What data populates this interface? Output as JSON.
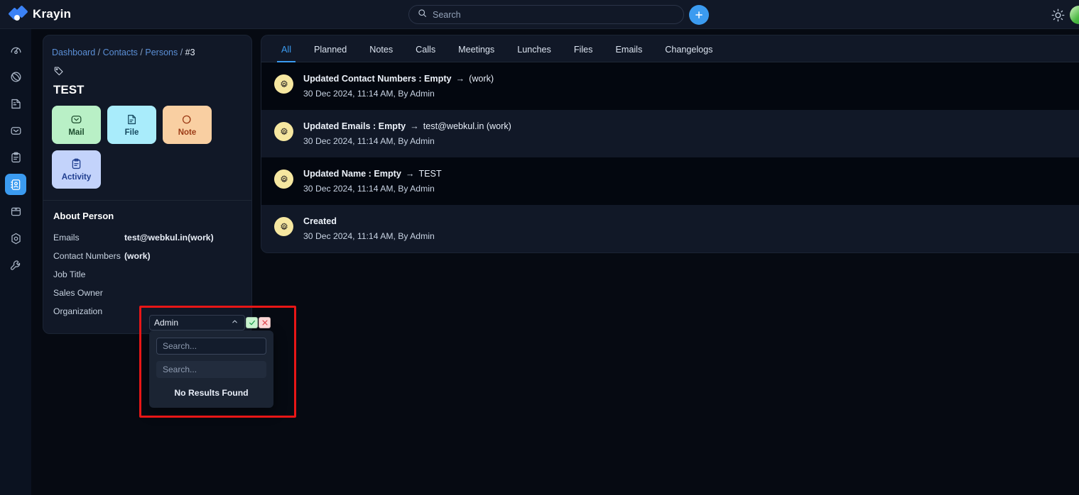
{
  "brand": {
    "name": "Krayin",
    "logo_icon": "krayin-diamond-logo"
  },
  "header": {
    "search_placeholder": "Search",
    "search_value": "",
    "search_icon": "search-icon",
    "create_button_icon": "plus-icon",
    "theme_toggle_icon": "sun-icon",
    "avatar_icon": "user-avatar"
  },
  "sidebar": {
    "items": [
      {
        "name": "dashboard",
        "icon": "speedometer-icon",
        "active": false
      },
      {
        "name": "leads",
        "icon": "atom-icon",
        "active": false
      },
      {
        "name": "quotes",
        "icon": "document-icon",
        "active": false
      },
      {
        "name": "mail",
        "icon": "envelope-icon",
        "active": false
      },
      {
        "name": "activities",
        "icon": "clipboard-icon",
        "active": false
      },
      {
        "name": "contacts",
        "icon": "contact-card-icon",
        "active": true
      },
      {
        "name": "products",
        "icon": "box-icon",
        "active": false
      },
      {
        "name": "settings",
        "icon": "hexagon-gear-icon",
        "active": false
      },
      {
        "name": "configuration",
        "icon": "wrench-icon",
        "active": false
      }
    ]
  },
  "left_panel": {
    "breadcrumb": [
      {
        "label": "Dashboard",
        "current": false
      },
      {
        "label": "Contacts",
        "current": false
      },
      {
        "label": "Persons",
        "current": false
      },
      {
        "label": "#3",
        "current": true
      }
    ],
    "tag_icon": "tag-icon",
    "person_name": "TEST",
    "action_cards": [
      {
        "label": "Mail",
        "icon": "envelope-icon",
        "theme": "mail"
      },
      {
        "label": "File",
        "icon": "file-icon",
        "theme": "file"
      },
      {
        "label": "Note",
        "icon": "note-icon",
        "theme": "note"
      },
      {
        "label": "Activity",
        "icon": "clipboard-icon",
        "theme": "activity"
      }
    ],
    "about_title": "About Person",
    "fields": [
      {
        "label": "Emails",
        "value": "test@webkul.in(work)"
      },
      {
        "label": "Contact Numbers",
        "value": "(work)"
      },
      {
        "label": "Job Title",
        "value": ""
      },
      {
        "label": "Sales Owner",
        "value": ""
      },
      {
        "label": "Organization",
        "value": ""
      }
    ]
  },
  "sales_owner_dropdown": {
    "selected_value": "Admin",
    "chevron_icon": "chevron-up-icon",
    "confirm_icon": "check-icon",
    "cancel_icon": "x-icon",
    "search_placeholder_1": "Search...",
    "search_value_1": "",
    "search_placeholder_2": "Search...",
    "search_value_2": "",
    "empty_text": "No Results Found",
    "highlight_color": "#e81616"
  },
  "right_panel": {
    "tabs": [
      {
        "label": "All",
        "active": true
      },
      {
        "label": "Planned",
        "active": false
      },
      {
        "label": "Notes",
        "active": false
      },
      {
        "label": "Calls",
        "active": false
      },
      {
        "label": "Meetings",
        "active": false
      },
      {
        "label": "Lunches",
        "active": false
      },
      {
        "label": "Files",
        "active": false
      },
      {
        "label": "Emails",
        "active": false
      },
      {
        "label": "Changelogs",
        "active": false
      }
    ],
    "activities": [
      {
        "icon": "gear-icon",
        "prefix": "Updated Contact Numbers : Empty",
        "arrow": "→",
        "suffix": "(work)",
        "meta": "30 Dec 2024, 11:14 AM, By Admin",
        "alt": true
      },
      {
        "icon": "gear-icon",
        "prefix": "Updated Emails : Empty",
        "arrow": "→",
        "suffix": "test@webkul.in (work)",
        "meta": "30 Dec 2024, 11:14 AM, By Admin",
        "alt": false
      },
      {
        "icon": "gear-icon",
        "prefix": "Updated Name : Empty",
        "arrow": "→",
        "suffix": "TEST",
        "meta": "30 Dec 2024, 11:14 AM, By Admin",
        "alt": true
      },
      {
        "icon": "gear-icon",
        "prefix": "Created",
        "arrow": "",
        "suffix": "",
        "meta": "30 Dec 2024, 11:14 AM, By Admin",
        "alt": false
      }
    ]
  },
  "colors": {
    "accent": "#3b9bf0",
    "page_bg": "#060a12",
    "panel_bg": "#111827",
    "highlight": "#e81616",
    "gear_badge": "#f6e7a0"
  }
}
